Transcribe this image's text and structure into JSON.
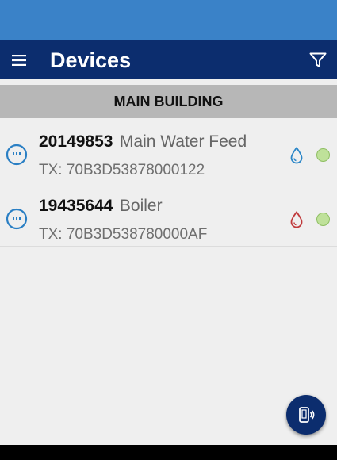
{
  "app_bar": {
    "title": "Devices",
    "menu_icon": "hamburger-menu-icon",
    "filter_icon": "filter-funnel-icon"
  },
  "section": {
    "title": "MAIN BUILDING"
  },
  "devices": [
    {
      "id": "20149853",
      "name": "Main Water Feed",
      "tx": "TX: 70B3D53878000122",
      "meter_icon": "meter-icon",
      "drop_icon": "water-drop-icon",
      "drop_color": "#2a86c8",
      "status_color": "#bfe19a"
    },
    {
      "id": "19435644",
      "name": "Boiler",
      "tx": "TX: 70B3D538780000AF",
      "meter_icon": "meter-icon",
      "drop_icon": "water-drop-icon",
      "drop_color": "#c0393b",
      "status_color": "#bfe19a"
    }
  ],
  "fab": {
    "icon": "nfc-phone-icon"
  },
  "colors": {
    "status_bar": "#3a82c8",
    "app_bar": "#0c2d6e",
    "section_header": "#b7b7b7",
    "meter_icon": "#2a7fc4"
  }
}
